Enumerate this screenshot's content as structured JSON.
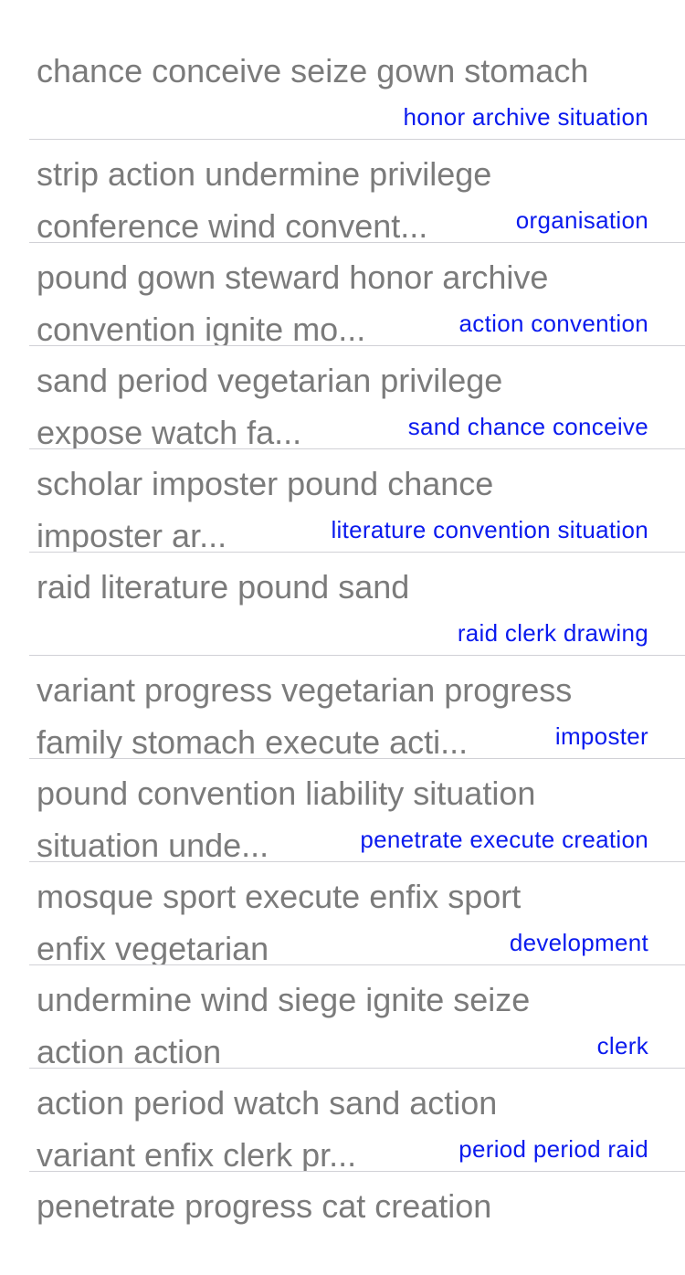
{
  "rows": [
    {
      "title1": "chance conceive seize gown stomach",
      "title2": "",
      "detail": "honor archive situation"
    },
    {
      "title1": "strip action undermine privilege",
      "title2": "conference wind convent...",
      "detail": "organisation"
    },
    {
      "title1": "pound gown steward honor archive",
      "title2": "convention ignite mo...",
      "detail": "action convention"
    },
    {
      "title1": "sand period vegetarian privilege",
      "title2": "expose watch fa...",
      "detail": "sand chance conceive"
    },
    {
      "title1": "scholar imposter pound chance",
      "title2": "imposter ar...",
      "detail": "literature convention situation"
    },
    {
      "title1": "raid literature pound sand",
      "title2": "",
      "detail": "raid clerk drawing"
    },
    {
      "title1": "variant progress vegetarian progress",
      "title2": "family stomach execute acti...",
      "detail": "imposter"
    },
    {
      "title1": "pound convention liability situation",
      "title2": "situation unde...",
      "detail": "penetrate execute creation"
    },
    {
      "title1": "mosque sport execute enfix sport",
      "title2": "enfix vegetarian",
      "detail": "development"
    },
    {
      "title1": "undermine wind siege ignite seize",
      "title2": "action action",
      "detail": "clerk"
    },
    {
      "title1": "action period watch sand action",
      "title2": "variant enfix clerk pr...",
      "detail": "period period raid"
    },
    {
      "title1": "penetrate progress cat creation",
      "title2": "",
      "detail": ""
    }
  ]
}
